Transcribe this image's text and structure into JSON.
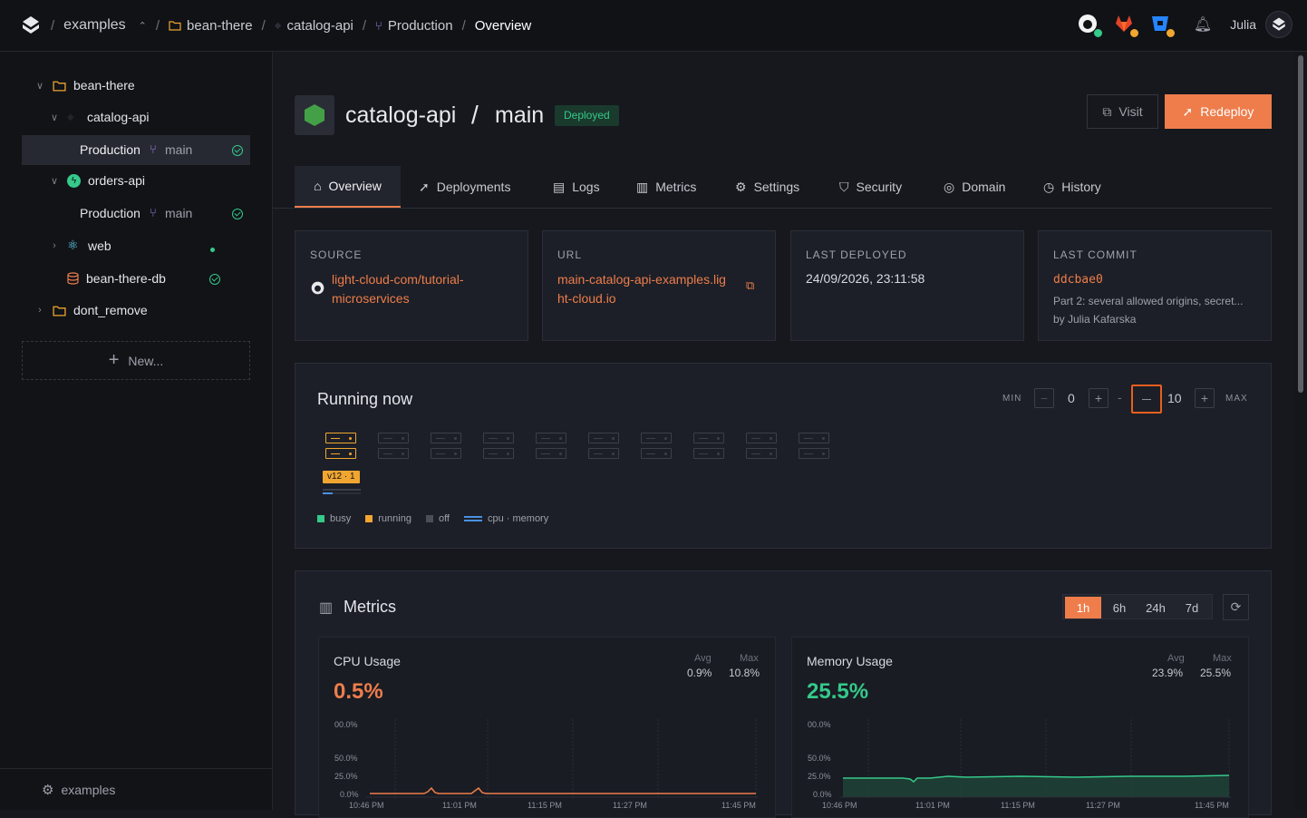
{
  "breadcrumb": {
    "org": "examples",
    "project": "bean-there",
    "service": "catalog-api",
    "environment": "Production",
    "page": "Overview"
  },
  "user": {
    "name": "Julia"
  },
  "sidebar": {
    "tree": [
      {
        "label": "bean-there"
      },
      {
        "label": "catalog-api"
      },
      {
        "label": "Production",
        "branch": "main"
      },
      {
        "label": "orders-api"
      },
      {
        "label": "Production",
        "branch": "main"
      },
      {
        "label": "web"
      },
      {
        "label": "bean-there-db"
      },
      {
        "label": "dont_remove"
      }
    ],
    "new_label": "New...",
    "footer_label": "examples"
  },
  "header": {
    "service": "catalog-api",
    "slash": "/",
    "branch": "main",
    "status": "Deployed",
    "visit_label": "Visit",
    "redeploy_label": "Redeploy"
  },
  "tabs": [
    "Overview",
    "Deployments",
    "Logs",
    "Metrics",
    "Settings",
    "Security",
    "Domain",
    "History"
  ],
  "cards": {
    "source": {
      "label": "SOURCE",
      "line1": "light-cloud-com/tutorial-",
      "line2": "microservices"
    },
    "url": {
      "label": "URL",
      "line1": "main-catalog-api-examples.lig",
      "line2": "ht-cloud.io"
    },
    "deployed": {
      "label": "LAST DEPLOYED",
      "value": "24/09/2026, 23:11:58"
    },
    "commit": {
      "label": "LAST COMMIT",
      "hash": "ddcbae0",
      "message": "Part 2: several allowed origins, secret...",
      "author": "by Julia Kafarska"
    }
  },
  "running": {
    "title": "Running now",
    "min_label": "MIN",
    "min_value": "0",
    "max_value": "10",
    "max_label": "MAX",
    "instance_tag": "v12 · 1",
    "legend": {
      "busy": "busy",
      "running": "running",
      "off": "off",
      "cpu_memory": "cpu · memory"
    }
  },
  "metrics": {
    "title": "Metrics",
    "ranges": [
      "1h",
      "6h",
      "24h",
      "7d"
    ],
    "selected_range": "1h",
    "cpu": {
      "title": "CPU Usage",
      "value": "0.5%",
      "avg_label": "Avg",
      "avg": "0.9%",
      "max_label": "Max",
      "max": "10.8%",
      "y_ticks": [
        "00.0%",
        "50.0%",
        "25.0%",
        "0.0%"
      ],
      "x_ticks": [
        "10:46 PM",
        "11:01 PM",
        "11:15 PM",
        "11:27 PM",
        "11:45 PM"
      ]
    },
    "memory": {
      "title": "Memory Usage",
      "value": "25.5%",
      "avg_label": "Avg",
      "avg": "23.9%",
      "max_label": "Max",
      "max": "25.5%",
      "y_ticks": [
        "00.0%",
        "50.0%",
        "25.0%",
        "0.0%"
      ],
      "x_ticks": [
        "10:46 PM",
        "11:01 PM",
        "11:15 PM",
        "11:27 PM",
        "11:45 PM"
      ]
    }
  },
  "colors": {
    "accent": "#ee7d4b",
    "ok": "#35c98a",
    "running": "#f0a630",
    "branch": "#9a82e8"
  }
}
